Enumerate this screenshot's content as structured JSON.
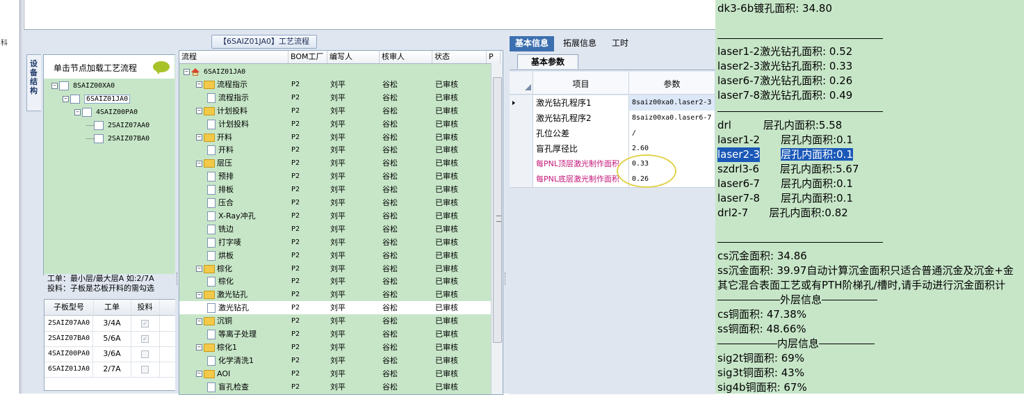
{
  "left_strip_char": "科",
  "flow_title": "【6SAIZ01JA0】工艺流程",
  "vertical_tab": "设备结构",
  "tree_header": "单击节点加载工艺流程",
  "tree": [
    {
      "label": "8SAIZ00XA0",
      "toggle": "−"
    },
    {
      "label": "6SAIZ01JA0",
      "toggle": "−",
      "selected": true
    },
    {
      "label": "4SAIZ00PA0",
      "toggle": "−"
    },
    {
      "label": "2SAIZ07AA0",
      "toggle": ""
    },
    {
      "label": "2SAIZ07BA0",
      "toggle": ""
    }
  ],
  "tree_info": [
    "工单：最小层/最大层A 如:2/7A",
    "投料：子板是芯板开料的需勾选"
  ],
  "sub_table": {
    "headers": [
      "子板型号",
      "工单",
      "投料"
    ],
    "rows": [
      {
        "model": "2SAIZ07AA0",
        "order": "3/4A",
        "checked": true
      },
      {
        "model": "2SAIZ07BA0",
        "order": "5/6A",
        "checked": true
      },
      {
        "model": "4SAIZ00PA0",
        "order": "3/6A",
        "checked": false
      },
      {
        "model": "6SAIZ01JA0",
        "order": "2/7A",
        "checked": false
      }
    ]
  },
  "process": {
    "headers": [
      "流程",
      "BOM工厂",
      "编写人",
      "核审人",
      "状态",
      "P"
    ],
    "root": "6SAIZ01JA0",
    "rows": [
      {
        "name": "流程指示",
        "type": "folder",
        "bom": "P2",
        "writer": "刘平",
        "reviewer": "谷松",
        "status": "已审核"
      },
      {
        "name": "流程指示",
        "type": "doc",
        "bom": "P2",
        "writer": "刘平",
        "reviewer": "谷松",
        "status": "已审核"
      },
      {
        "name": "计划投料",
        "type": "folder",
        "bom": "P2",
        "writer": "刘平",
        "reviewer": "谷松",
        "status": "已审核"
      },
      {
        "name": "计划投料",
        "type": "doc",
        "bom": "P2",
        "writer": "刘平",
        "reviewer": "谷松",
        "status": "已审核"
      },
      {
        "name": "开料",
        "type": "folder",
        "bom": "P2",
        "writer": "刘平",
        "reviewer": "谷松",
        "status": "已审核"
      },
      {
        "name": "开料",
        "type": "doc",
        "bom": "P2",
        "writer": "刘平",
        "reviewer": "谷松",
        "status": "已审核"
      },
      {
        "name": "层压",
        "type": "folder",
        "bom": "P2",
        "writer": "刘平",
        "reviewer": "谷松",
        "status": "已审核"
      },
      {
        "name": "预排",
        "type": "doc",
        "bom": "P2",
        "writer": "刘平",
        "reviewer": "谷松",
        "status": "已审核"
      },
      {
        "name": "排板",
        "type": "doc",
        "bom": "P2",
        "writer": "刘平",
        "reviewer": "谷松",
        "status": "已审核"
      },
      {
        "name": "压合",
        "type": "doc",
        "bom": "P2",
        "writer": "刘平",
        "reviewer": "谷松",
        "status": "已审核"
      },
      {
        "name": "X-Ray冲孔",
        "type": "doc",
        "bom": "P2",
        "writer": "刘平",
        "reviewer": "谷松",
        "status": "已审核"
      },
      {
        "name": "铣边",
        "type": "doc",
        "bom": "P2",
        "writer": "刘平",
        "reviewer": "谷松",
        "status": "已审核"
      },
      {
        "name": "打字唛",
        "type": "doc",
        "bom": "P2",
        "writer": "刘平",
        "reviewer": "谷松",
        "status": "已审核"
      },
      {
        "name": "烘板",
        "type": "doc",
        "bom": "P2",
        "writer": "刘平",
        "reviewer": "谷松",
        "status": "已审核"
      },
      {
        "name": "棕化",
        "type": "folder",
        "bom": "P2",
        "writer": "刘平",
        "reviewer": "谷松",
        "status": "已审核"
      },
      {
        "name": "棕化",
        "type": "doc",
        "bom": "P2",
        "writer": "刘平",
        "reviewer": "谷松",
        "status": "已审核"
      },
      {
        "name": "激光钻孔",
        "type": "folder",
        "bom": "P2",
        "writer": "刘平",
        "reviewer": "谷松",
        "status": "已审核"
      },
      {
        "name": "激光钻孔",
        "type": "doc",
        "bom": "P2",
        "writer": "刘平",
        "reviewer": "谷松",
        "status": "已审核",
        "selected": true
      },
      {
        "name": "沉铜",
        "type": "folder",
        "bom": "P2",
        "writer": "刘平",
        "reviewer": "谷松",
        "status": "已审核"
      },
      {
        "name": "等离子处理",
        "type": "doc",
        "bom": "P2",
        "writer": "刘平",
        "reviewer": "谷松",
        "status": "已审核"
      },
      {
        "name": "棕化1",
        "type": "folder",
        "bom": "P2",
        "writer": "刘平",
        "reviewer": "谷松",
        "status": "已审核"
      },
      {
        "name": "化学清洗1",
        "type": "doc",
        "bom": "P2",
        "writer": "刘平",
        "reviewer": "谷松",
        "status": "已审核"
      },
      {
        "name": "AOI",
        "type": "folder",
        "bom": "P2",
        "writer": "刘平",
        "reviewer": "谷松",
        "status": "已审核"
      },
      {
        "name": "盲孔检查",
        "type": "doc",
        "bom": "P2",
        "writer": "刘平",
        "reviewer": "谷松",
        "status": "已审核"
      }
    ]
  },
  "info_tabs": [
    "基本信息",
    "拓展信息",
    "工时"
  ],
  "info_subtab": "基本参数",
  "params": {
    "headers": [
      "项目",
      "参数"
    ],
    "rows": [
      {
        "key": "激光钻孔程序1",
        "value": "8saiz00xa0.laser2-3",
        "current": true
      },
      {
        "key": "激光钻孔程序2",
        "value": "8saiz00xa0.laser6-7"
      },
      {
        "key": "孔位公差",
        "value": "/"
      },
      {
        "key": "盲孔厚径比",
        "value": "2.60"
      },
      {
        "key": "每PNL顶层激光制作面积",
        "value": "0.33",
        "pink": true
      },
      {
        "key": "每PNL底层激光制作面积",
        "value": "0.26",
        "pink": true
      }
    ]
  },
  "notes": {
    "line0": "dk3-6b镀孔面积: 34.80",
    "laser_area": [
      "laser1-2激光钻孔面积: 0.52",
      "laser2-3激光钻孔面积: 0.33",
      "laser6-7激光钻孔面积: 0.26",
      "laser7-8激光钻孔面积: 0.49"
    ],
    "inner_area": [
      {
        "name": "drl",
        "value": "层孔内面积:5.58"
      },
      {
        "name": "laser1-2",
        "value": "层孔内面积:0.1"
      },
      {
        "name": "laser2-3",
        "value": "层孔内面积:0.1",
        "highlight": true
      },
      {
        "name": "szdrl3-6",
        "value": "层孔内面积:5.67"
      },
      {
        "name": "laser6-7",
        "value": "层孔内面积:0.1"
      },
      {
        "name": "laser7-8",
        "value": "层孔内面积:0.1"
      },
      {
        "name": "drl2-7",
        "value": "层孔内面积:0.82"
      }
    ],
    "cs_gold": "cs沉金面积: 34.86",
    "ss_gold": "ss沉金面积: 39.97自动计算沉金面积只适合普通沉金及沉金+金",
    "gold_note": "其它混合表面工艺或有PTH阶梯孔/槽时,请手动进行沉金面积计",
    "outer_title": "外层信息",
    "cs_copper": "cs铜面积: 47.38%",
    "ss_copper": "ss铜面积: 48.66%",
    "inner_title": "内层信息",
    "sig": [
      "sig2t铜面积: 69%",
      "sig3t铜面积: 43%",
      "sig4b铜面积: 67%"
    ]
  }
}
